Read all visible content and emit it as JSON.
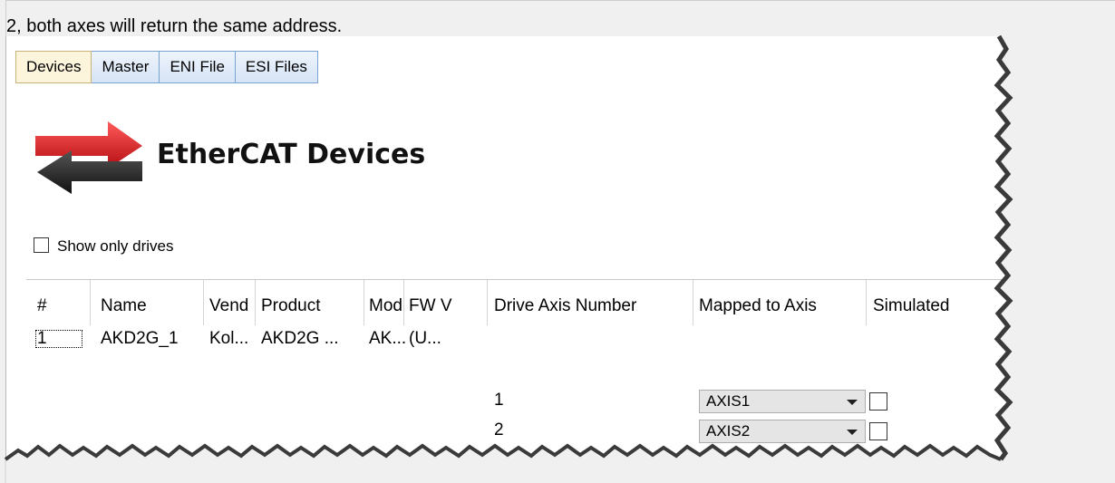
{
  "document": {
    "text": "2, both axes will return the same address."
  },
  "tabs": [
    {
      "label": "Devices",
      "active": true
    },
    {
      "label": "Master",
      "active": false
    },
    {
      "label": "ENI File",
      "active": false
    },
    {
      "label": "ESI Files",
      "active": false
    }
  ],
  "header": {
    "title": "EtherCAT Devices",
    "icon": "ethercat-arrows-icon"
  },
  "filter": {
    "show_only_drives_label": "Show only drives",
    "show_only_drives_checked": false
  },
  "grid": {
    "columns": [
      "#",
      "Name",
      "Vend",
      "Product",
      "Mod",
      "FW V",
      "Drive Axis Number",
      "Mapped to Axis",
      "Simulated"
    ],
    "row": {
      "index": "1",
      "name": "AKD2G_1",
      "vendor": "Kol...",
      "product": "AKD2G ...",
      "model": "AK...",
      "fw": "(U..."
    },
    "axes": [
      {
        "drive_axis_number": "1",
        "mapped_to_axis": "AXIS1",
        "simulated": false
      },
      {
        "drive_axis_number": "2",
        "mapped_to_axis": "AXIS2",
        "simulated": false
      }
    ]
  },
  "colors": {
    "tab_active": "#fdf4dc",
    "tab_inactive": "#dbe7f6",
    "arrow_red": "#e8232a",
    "arrow_dark": "#333333"
  }
}
